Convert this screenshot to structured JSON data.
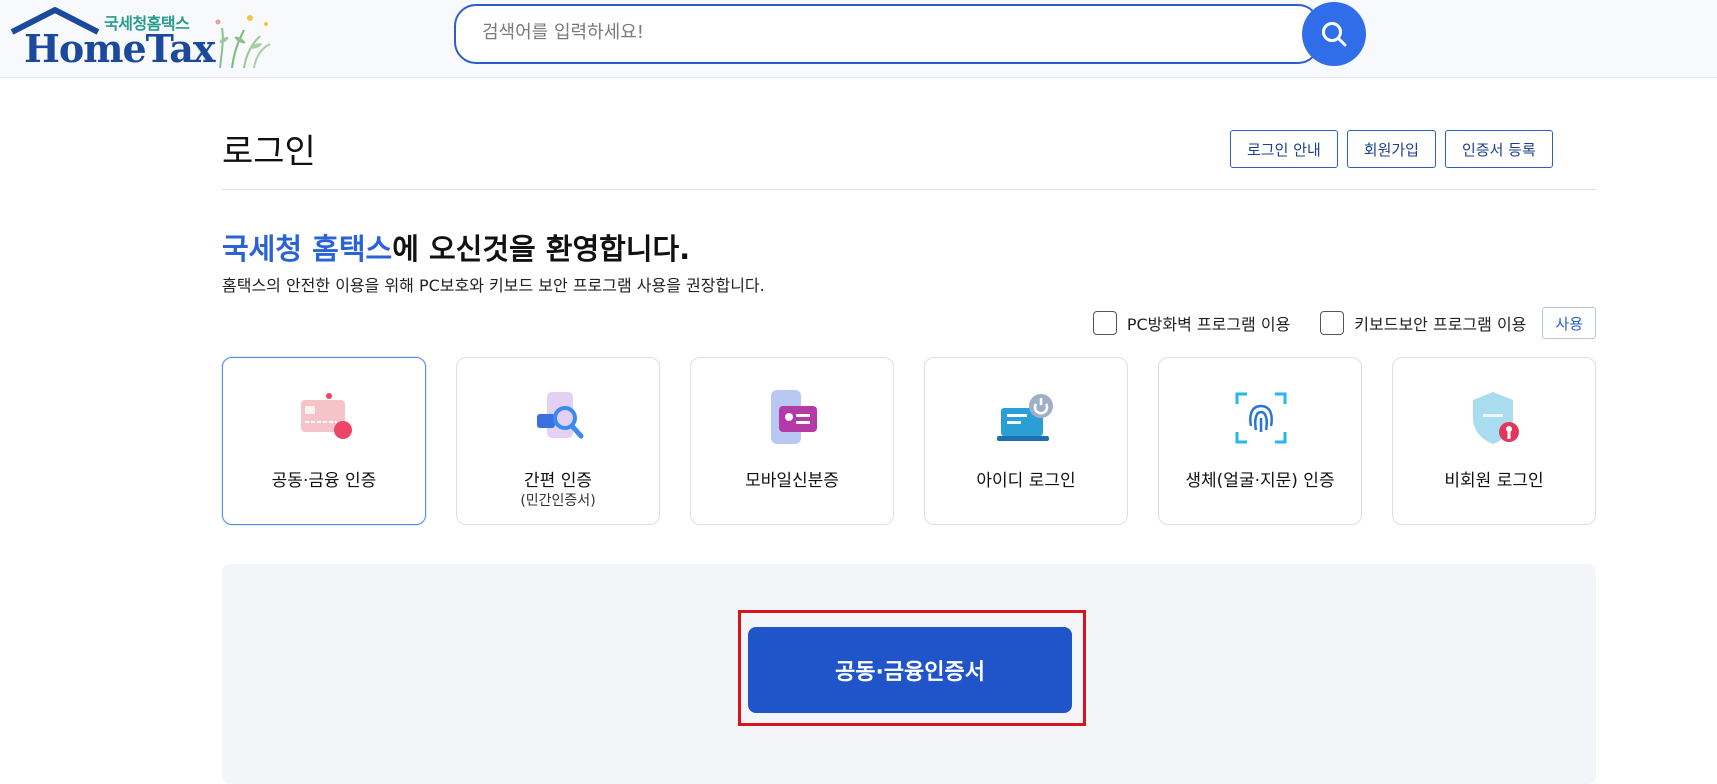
{
  "header": {
    "logo_sub": "국세청홈택스",
    "logo_main": "HomeTax",
    "search_placeholder": "검색어를 입력하세요!"
  },
  "page": {
    "title": "로그인",
    "top_buttons": [
      "로그인 안내",
      "회원가입",
      "인증서 등록"
    ]
  },
  "welcome": {
    "highlight": "국세청 홈택스",
    "rest": "에 오신것을 환영합니다.",
    "description": "홈택스의 안전한 이용을 위해 PC보호와 키보드 보안 프로그램 사용을 권장합니다."
  },
  "options": {
    "firewall_label": "PC방화벽 프로그램 이용",
    "keyboard_label": "키보드보안 프로그램 이용",
    "use_button": "사용"
  },
  "login_methods": [
    {
      "label": "공동·금융 인증",
      "sub": "",
      "icon": "certificate-card-icon",
      "active": true
    },
    {
      "label": "간편 인증",
      "sub": "(민간인증서)",
      "icon": "simple-auth-icon",
      "active": false
    },
    {
      "label": "모바일신분증",
      "sub": "",
      "icon": "mobile-id-icon",
      "active": false
    },
    {
      "label": "아이디 로그인",
      "sub": "",
      "icon": "id-login-icon",
      "active": false
    },
    {
      "label": "생체(얼굴·지문) 인증",
      "sub": "",
      "icon": "fingerprint-icon",
      "active": false
    },
    {
      "label": "비회원 로그인",
      "sub": "",
      "icon": "guest-shield-icon",
      "active": false
    }
  ],
  "main_button": "공동·금융인증서",
  "colors": {
    "accent": "#2a63d6",
    "button": "#1f55c8",
    "highlight_frame": "#d8131b"
  }
}
